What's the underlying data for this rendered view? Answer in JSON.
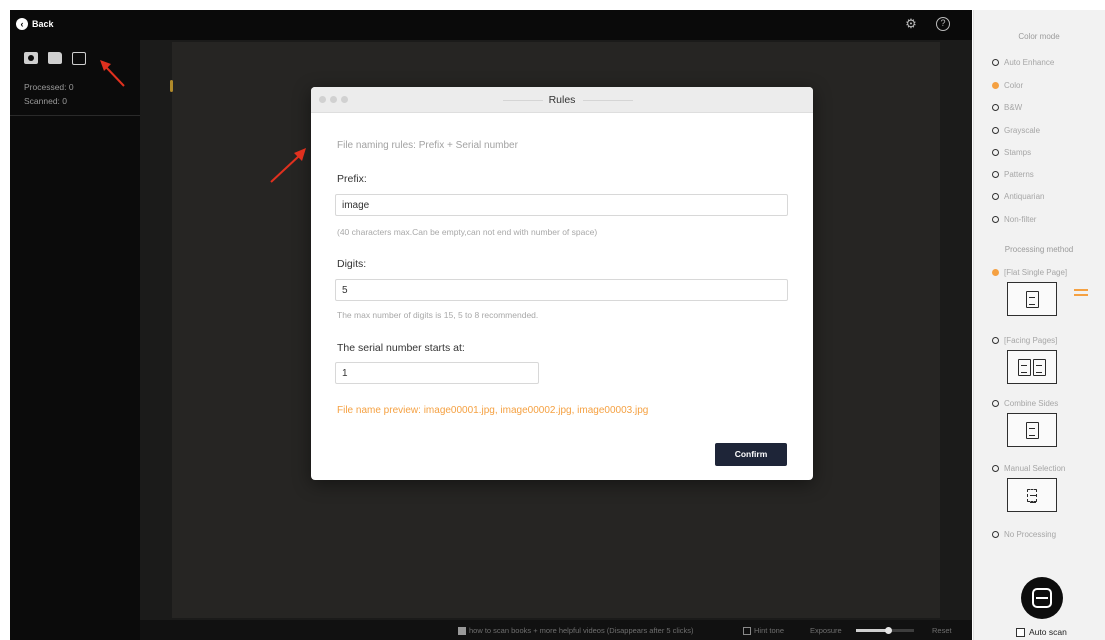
{
  "topbar": {
    "back_label": "Back",
    "settings_icon": "gear-icon",
    "help_icon": "help-icon"
  },
  "left_panel": {
    "tools": [
      "camera-icon",
      "folder-icon",
      "edit-icon"
    ],
    "processed": "Processed: 0",
    "scanned": "Scanned: 0"
  },
  "modal": {
    "title": "Rules",
    "naming_rule": "File naming rules: Prefix + Serial number",
    "prefix_label": "Prefix:",
    "prefix_value": "image",
    "prefix_help": "(40 characters max.Can be empty,can not end with number of space)",
    "digits_label": "Digits:",
    "digits_value": "5",
    "digits_help": "The max number of digits is 15, 5 to 8 recommended.",
    "start_label": "The serial number starts at:",
    "start_value": "1",
    "preview": "File name preview: image00001.jpg, image00002.jpg, image00003.jpg",
    "confirm_label": "Confirm"
  },
  "right_panel": {
    "color_mode_heading": "Color mode",
    "color_modes": [
      {
        "label": "Auto Enhance",
        "selected": false
      },
      {
        "label": "Color",
        "selected": true
      },
      {
        "label": "B&W",
        "selected": false
      },
      {
        "label": "Grayscale",
        "selected": false
      },
      {
        "label": "Stamps",
        "selected": false
      },
      {
        "label": "Patterns",
        "selected": false
      },
      {
        "label": "Antiquarian",
        "selected": false
      },
      {
        "label": "Non-filter",
        "selected": false
      }
    ],
    "processing_heading": "Processing method",
    "processing_methods": [
      {
        "label": "[Flat Single Page]",
        "selected": true
      },
      {
        "label": "[Facing Pages]",
        "selected": false
      },
      {
        "label": "Combine Sides",
        "selected": false
      },
      {
        "label": "Manual Selection",
        "selected": false
      },
      {
        "label": "No Processing",
        "selected": false
      }
    ],
    "auto_scan_label": "Auto scan"
  },
  "bottom_bar": {
    "tip": "how to scan books + more helpful videos (Disappears after 5 clicks)",
    "hint_tone": "Hint tone",
    "exposure": "Exposure",
    "exposure_level": 0.55,
    "reset": "Reset"
  },
  "colors": {
    "accent": "#f5a142",
    "confirm_bg": "#1e2538",
    "annotation_arrow": "#e0301e"
  }
}
